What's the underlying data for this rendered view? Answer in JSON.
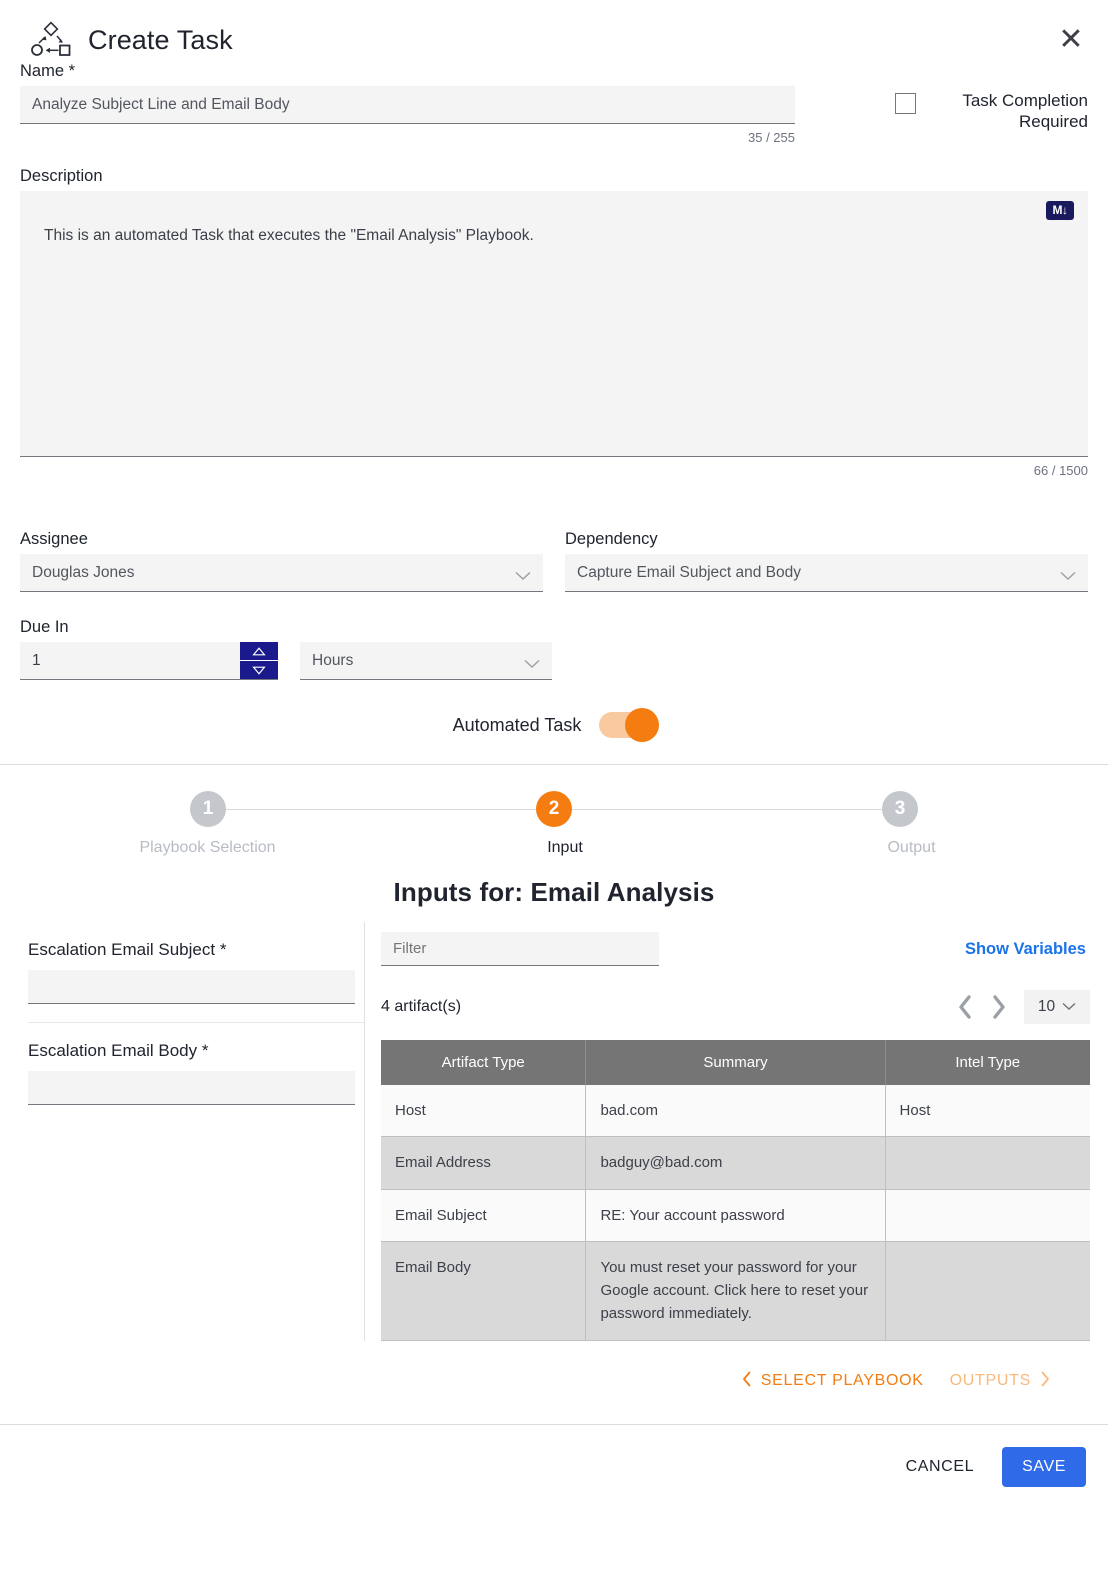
{
  "dialog": {
    "title": "Create Task",
    "icon": "workflow-icon",
    "close_icon": "close-icon"
  },
  "name_field": {
    "label": "Name *",
    "value": "Analyze Subject Line and Email Body",
    "counter": "35 / 255"
  },
  "task_completion": {
    "label": "Task Completion Required",
    "checked": false
  },
  "description": {
    "label": "Description",
    "value": "This is an automated Task that executes the \"Email Analysis\" Playbook.",
    "counter": "66 / 1500",
    "markdown_badge": "M↓"
  },
  "assignee": {
    "label": "Assignee",
    "value": "Douglas Jones"
  },
  "dependency": {
    "label": "Dependency",
    "value": "Capture Email Subject and Body"
  },
  "due_in": {
    "label": "Due In",
    "value": "1",
    "unit": "Hours"
  },
  "automated_task": {
    "label": "Automated Task",
    "enabled": true,
    "accent": "#f57c10"
  },
  "wizard": {
    "steps": [
      {
        "number": "1",
        "label": "Playbook Selection",
        "state": "inactive"
      },
      {
        "number": "2",
        "label": "Input",
        "state": "active"
      },
      {
        "number": "3",
        "label": "Output",
        "state": "inactive"
      }
    ],
    "heading": "Inputs for: Email Analysis"
  },
  "inputs_pane": {
    "fields": [
      {
        "label": "Escalation Email Subject *",
        "value": ""
      },
      {
        "label": "Escalation Email Body *",
        "value": ""
      }
    ]
  },
  "artifacts_pane": {
    "filter_placeholder": "Filter",
    "filter_value": "",
    "show_variables": "Show Variables",
    "count_text": "4 artifact(s)",
    "page_size": "10",
    "prev_icon": "chevron-left-icon",
    "next_icon": "chevron-right-icon",
    "columns": [
      "Artifact Type",
      "Summary",
      "Intel Type"
    ],
    "rows": [
      {
        "type": "Host",
        "summary": "bad.com",
        "intel": "Host"
      },
      {
        "type": "Email Address",
        "summary": "badguy@bad.com",
        "intel": ""
      },
      {
        "type": "Email Subject",
        "summary": "RE: Your account password",
        "intel": ""
      },
      {
        "type": "Email Body",
        "summary": "You must reset your password for your Google account. Click here to reset your password immediately.",
        "intel": ""
      }
    ]
  },
  "wizard_nav": {
    "prev_label": "SELECT PLAYBOOK",
    "next_label": "OUTPUTS"
  },
  "footer": {
    "cancel_label": "CANCEL",
    "save_label": "SAVE",
    "save_color": "#2f6be8"
  }
}
